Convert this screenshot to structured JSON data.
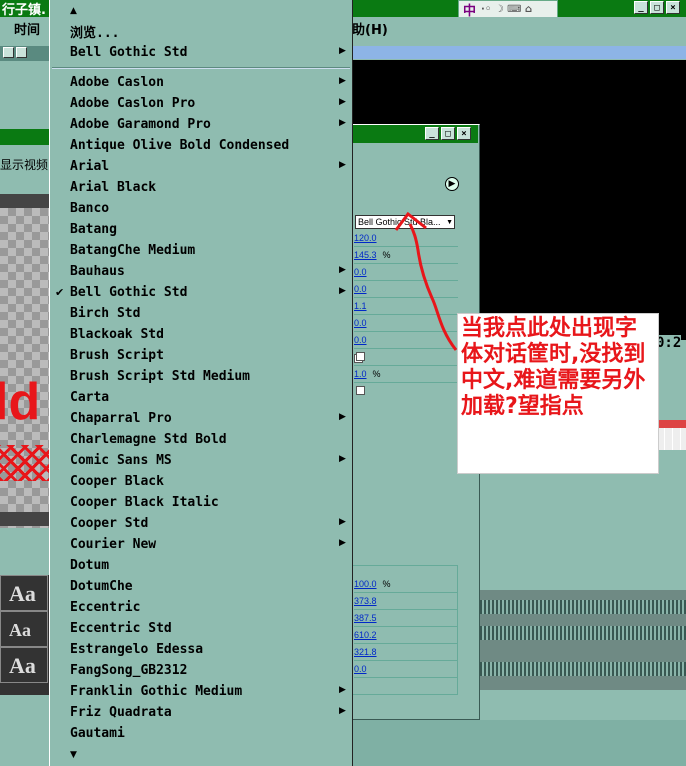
{
  "titlebar": {
    "title": "行子镇.",
    "ime_glyph": "中",
    "ime_extra": "·◦ ☽ ⌨ ⌂",
    "window_buttons": [
      "_",
      "□",
      "×"
    ]
  },
  "menubar": {
    "left_item": "时间",
    "right_item": "助(H)"
  },
  "left_panel": {
    "label_show_video": "显示视频",
    "preview_text": "ld",
    "thumbs": [
      "Aa",
      "Aa",
      "Aa"
    ]
  },
  "font_menu": {
    "top_arrow": "▲",
    "browse": "浏览...",
    "recent": "Bell Gothic Std",
    "items": [
      {
        "label": "Adobe Caslon",
        "submenu": true
      },
      {
        "label": "Adobe Caslon Pro",
        "submenu": true
      },
      {
        "label": "Adobe Garamond Pro",
        "submenu": true
      },
      {
        "label": "Antique Olive Bold Condensed",
        "submenu": false
      },
      {
        "label": "Arial",
        "submenu": true
      },
      {
        "label": "Arial Black",
        "submenu": false
      },
      {
        "label": "Banco",
        "submenu": false
      },
      {
        "label": "Batang",
        "submenu": false
      },
      {
        "label": "BatangChe Medium",
        "submenu": false
      },
      {
        "label": "Bauhaus",
        "submenu": true
      },
      {
        "label": "Bell Gothic Std",
        "submenu": true,
        "checked": true
      },
      {
        "label": "Birch Std",
        "submenu": false
      },
      {
        "label": "Blackoak Std",
        "submenu": false
      },
      {
        "label": "Brush Script",
        "submenu": false
      },
      {
        "label": "Brush Script Std Medium",
        "submenu": false
      },
      {
        "label": "Carta",
        "submenu": false
      },
      {
        "label": "Chaparral Pro",
        "submenu": true
      },
      {
        "label": "Charlemagne Std Bold",
        "submenu": false
      },
      {
        "label": "Comic Sans MS",
        "submenu": true
      },
      {
        "label": "Cooper Black",
        "submenu": false
      },
      {
        "label": "Cooper Black Italic",
        "submenu": false
      },
      {
        "label": "Cooper Std",
        "submenu": true
      },
      {
        "label": "Courier New",
        "submenu": true
      },
      {
        "label": "Dotum",
        "submenu": false
      },
      {
        "label": "DotumChe",
        "submenu": false
      },
      {
        "label": "Eccentric",
        "submenu": false
      },
      {
        "label": "Eccentric Std",
        "submenu": false
      },
      {
        "label": "Estrangelo Edessa",
        "submenu": false
      },
      {
        "label": "FangSong_GB2312",
        "submenu": false
      },
      {
        "label": "Franklin Gothic Medium",
        "submenu": true
      },
      {
        "label": "Friz Quadrata",
        "submenu": true
      },
      {
        "label": "Gautami",
        "submenu": false
      }
    ],
    "bottom_arrow": "▼"
  },
  "dialog": {
    "window_buttons": [
      "_",
      "□",
      "×"
    ],
    "font_select_value": "Bell Gothic Std Bla...",
    "props_top": [
      {
        "value": "120.0",
        "unit": ""
      },
      {
        "value": "145.3",
        "unit": "%"
      },
      {
        "value": "0.0",
        "unit": ""
      },
      {
        "value": "0.0",
        "unit": ""
      },
      {
        "value": "1.1",
        "unit": ""
      },
      {
        "value": "0.0",
        "unit": ""
      },
      {
        "value": "0.0",
        "unit": ""
      },
      {
        "value": "",
        "unit": ""
      },
      {
        "value": "1.0",
        "unit": "%"
      }
    ],
    "props_bottom": [
      {
        "value": "100.0",
        "unit": "%"
      },
      {
        "value": "373.8",
        "unit": ""
      },
      {
        "value": "387.5",
        "unit": ""
      },
      {
        "value": "610.2",
        "unit": ""
      },
      {
        "value": "321.8",
        "unit": ""
      },
      {
        "value": "0.0",
        "unit": ""
      }
    ]
  },
  "monitor": {
    "timecode": "0:2"
  },
  "annotation": {
    "text": "当我点此处出现字体对话筐时,没找到中文,难道需要另外加载?望指点",
    "color": "#e8161a"
  },
  "colors": {
    "panel_bg": "#8fbcb0",
    "title_green": "#0a7a12",
    "link_blue": "#0028c8"
  }
}
